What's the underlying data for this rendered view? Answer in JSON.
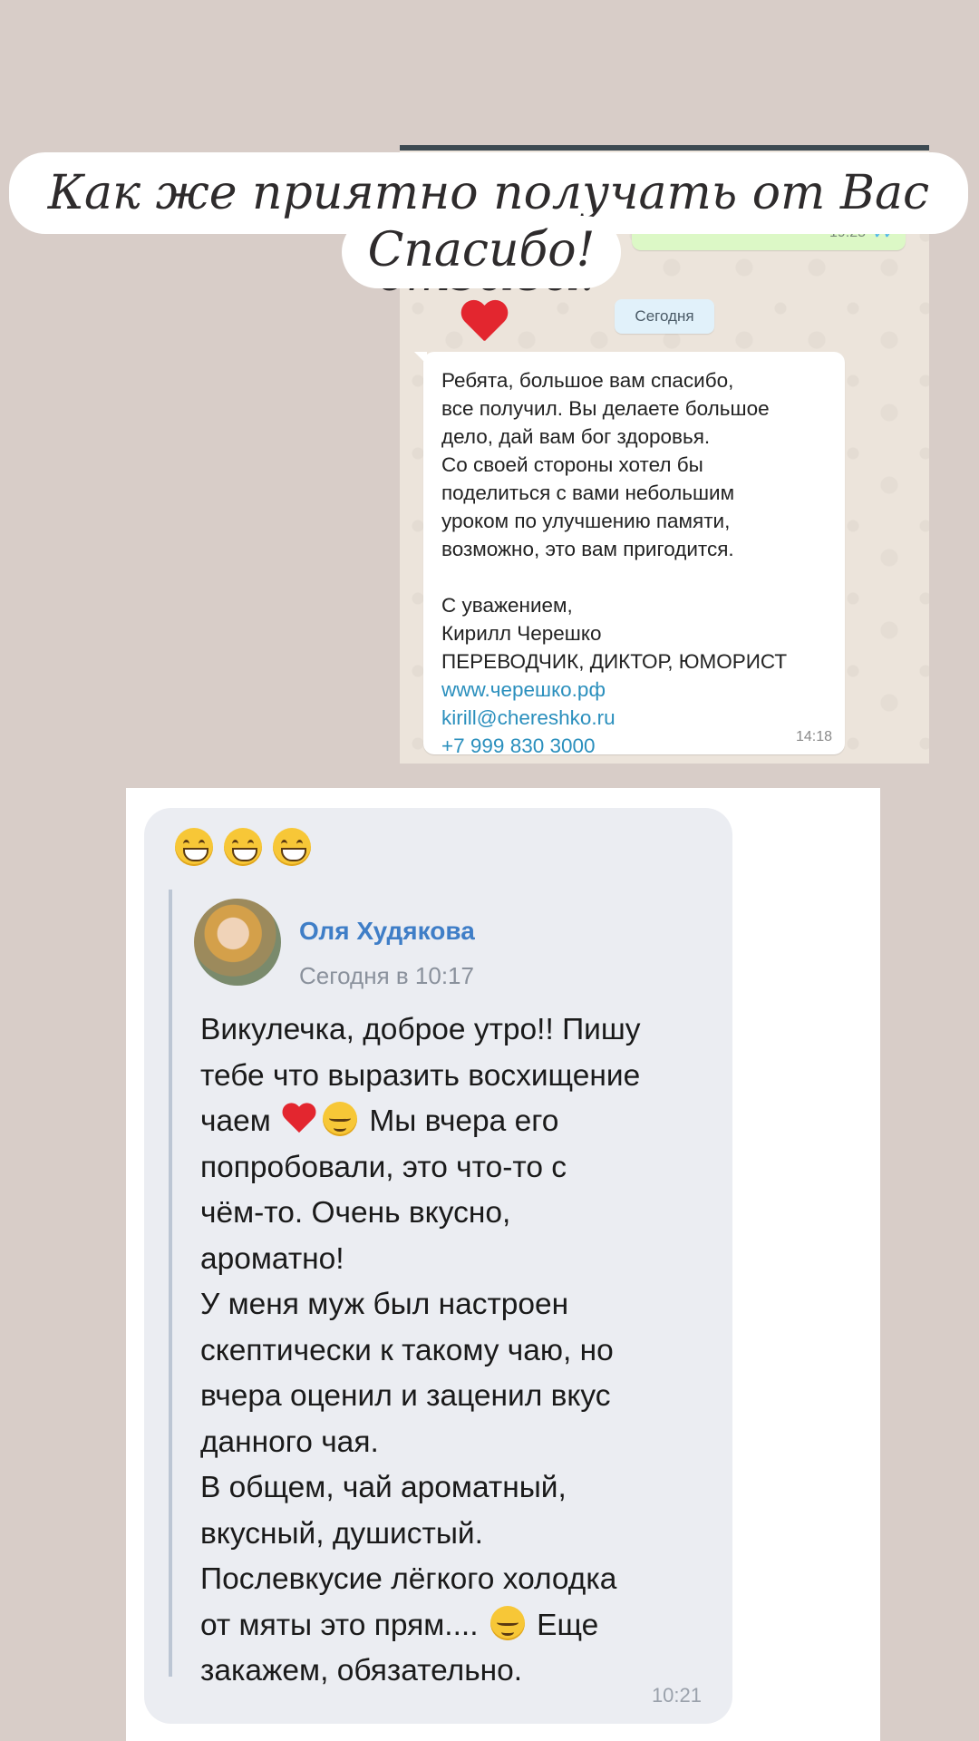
{
  "headline": {
    "line1": "Как же приятно получать от Вас отзывы!",
    "line2": "Спасибо!",
    "heart_icon": "red-heart"
  },
  "chat1": {
    "outgoing": {
      "link_fragment": "...",
      "time": "19:25",
      "status_icon": "double-check"
    },
    "date_divider": "Сегодня",
    "incoming": {
      "lines": [
        "Ребята, большое вам спасибо,",
        "все получил. Вы делаете большое",
        "дело, дай вам бог здоровья.",
        "Со своей стороны хотел бы",
        "поделиться с вами небольшим",
        "уроком по улучшению памяти,",
        "возможно, это вам пригодится."
      ],
      "signature": [
        "С уважением,",
        "Кирилл Черешко",
        "ПЕРЕВОДЧИК, ДИКТОР, ЮМОРИСТ"
      ],
      "website": "www.черешко.рф",
      "email": "kirill@chereshko.ru",
      "phone": "+7 999 830 3000",
      "time": "14:18"
    }
  },
  "chat2": {
    "emoji_row": [
      "grinning-face",
      "grinning-face",
      "grinning-face"
    ],
    "author": "Оля Худякова",
    "timestamp": "Сегодня в 10:17",
    "lines": {
      "l1": "Викулечка, доброе утро!! Пишу",
      "l2": "тебе что выразить восхищение",
      "l3a": "чаем",
      "l3b": "Мы вчера его",
      "l4": "попробовали, это что-то с",
      "l5": "чём-то. Очень вкусно,",
      "l6": "ароматно!",
      "l7": "У меня муж был настроен",
      "l8": "скептически к такому чаю, но",
      "l9": "вчера оценил и заценил вкус",
      "l10": "данного чая.",
      "l11": "В общем, чай ароматный,",
      "l12": "вкусный, душистый.",
      "l13": "Послевкусие лёгкого холодка",
      "l14a": "от мяты это прям....",
      "l14b": "Еще",
      "l15": "закажем, обязательно."
    },
    "time": "10:21"
  }
}
